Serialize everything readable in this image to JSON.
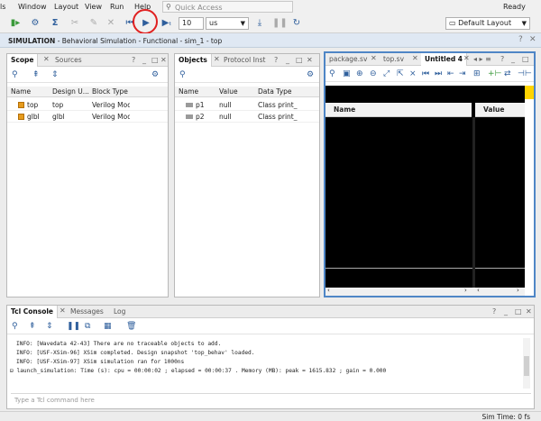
{
  "menu": [
    "ls",
    "Window",
    "Layout",
    "View",
    "Run",
    "Help"
  ],
  "quick_access": {
    "icon": "search-icon",
    "placeholder": "Quick Access"
  },
  "status_ready": "Ready",
  "toolbar": {
    "time_value": "10",
    "time_unit": "us",
    "layout": "Default Layout"
  },
  "simulation_bar": {
    "prefix": "SIMULATION",
    "title": " - Behavioral Simulation - Functional - sim_1 - top"
  },
  "scope_panel": {
    "tabs": [
      "Scope",
      "Sources"
    ],
    "columns": [
      "Name",
      "Design U...",
      "Block Type"
    ],
    "rows": [
      {
        "name": "top",
        "design_unit": "top",
        "block_type": "Verilog Modu"
      },
      {
        "name": "glbl",
        "design_unit": "glbl",
        "block_type": "Verilog Modu"
      }
    ]
  },
  "objects_panel": {
    "tabs": [
      "Objects",
      "Protocol Inst"
    ],
    "columns": [
      "Name",
      "Value",
      "Data Type"
    ],
    "rows": [
      {
        "name": "p1",
        "value": "null",
        "data_type": "Class print_"
      },
      {
        "name": "p2",
        "value": "null",
        "data_type": "Class print_"
      }
    ]
  },
  "wave_panel": {
    "tabs": [
      "package.sv",
      "top.sv",
      "Untitled 4"
    ],
    "columns": [
      "Name",
      "Value"
    ]
  },
  "console_panel": {
    "tabs": [
      "Tcl Console",
      "Messages",
      "Log"
    ],
    "lines": [
      "INFO: [Wavedata 42-43] There are no traceable objects to add.",
      "INFO: [USF-XSim-96] XSim completed. Design snapshot 'top_behav' loaded.",
      "INFO: [USF-XSim-97] XSim simulation ran for 1000ns",
      "launch_simulation: Time (s): cpu = 00:00:02 ; elapsed = 00:00:37 . Memory (MB): peak = 1615.832 ; gain = 0.000"
    ],
    "command_placeholder": "Type a Tcl command here"
  },
  "statusbar": {
    "sim_time": "Sim Time: 0 fs"
  },
  "colors": {
    "accent": "#4f86c6",
    "highlight": "#e02020",
    "wave_bg": "#000000"
  }
}
